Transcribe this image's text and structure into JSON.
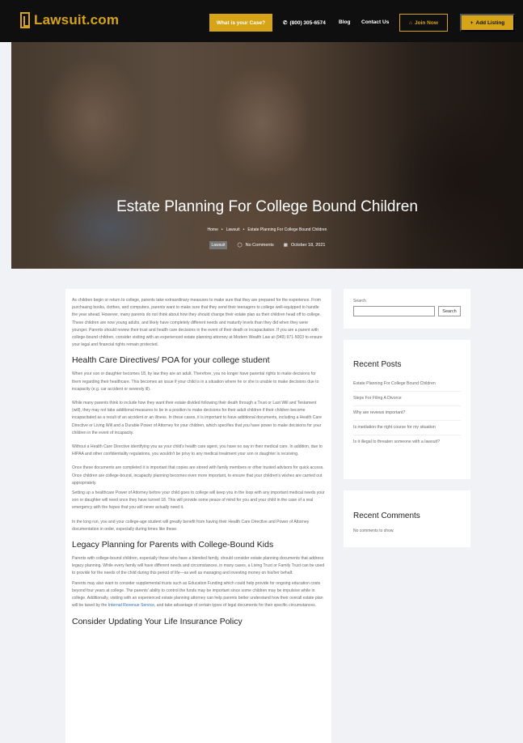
{
  "header": {
    "logo": "Lawsuit.com",
    "case_button": "What is your Case?",
    "phone": "(800) 305-6574",
    "nav_blog": "Blog",
    "nav_contact": "Contact Us",
    "join": "Join Now",
    "add_listing": "Add Listing"
  },
  "hero": {
    "title": "Estate Planning For College Bound Children",
    "breadcrumb": [
      "Home",
      "Lawsuit",
      "Estate Planning For College Bound Children"
    ],
    "tag": "Lawsuit",
    "comments": "No Comments",
    "date": "October 18, 2021"
  },
  "article": {
    "intro": "As children begin or return to college, parents take extraordinary measures to make sure that they are prepared for the experience. From purchasing books, clothes, and computers, parents want to make sure that they send their teenagers to college well-equipped to handle the year ahead. However, many parents do not think about how they should change their estate plan as their children head off to college. These children are now young adults, and likely have completely different needs and maturity levels than they did when they were younger. Parents should review their trust and health care decisions in the event of their death or incapacitation. If you are a parent with college-bound children, consider visiting with an experienced estate planning attorney at Modern Wealth Law at (949) 971-5003 to ensure your legal and financial rights remain protected.",
    "h1": "Health Care Directives/ POA for your college student",
    "p1": "When your son or daughter becomes 18, by law they are an adult. Therefore, you no longer have parental rights to make decisions for them regarding their healthcare. This becomes an issue if your child is in a situation where he or she is unable to make decisions due to incapacity (e.g. car accident or severely ill).",
    "p2": "While many parents think to include how they want their estate divided following their death through a Trust or Last Will and Testament (will), they may not take additional measures to be in a position to make decisions for their adult children if their children become incapacitated as a result of an accident or an illness. In these cases, it is important to have additional documents, including a Health Care Directive or Living Will and a Durable Power of Attorney for your children, which specifies that you have power to make decisions for your children in the event of incapacity.",
    "p3": "Without a Health Care Directive identifying you as your child's health care agent, you have no say in their medical care. In addition, due to HIPAA and other confidentiality regulations, you wouldn't be privy to any medical treatment your son or daughter is receiving.",
    "p4": "Once these documents are completed it is important that copies are stored with family members or other trusted advisors for quick access. Once children are college-bound, incapacity planning becomes even more important, to ensure that your children's wishes are carried out appropriately.",
    "p5": "Setting up a healthcare Power of Attorney before your child goes to college will keep you in the loop with any important medical needs your son or daughter will need once they have turned 18. This will provide some peace of mind for you and your child in the case of a real emergency with the hopes that you will never actually need it.",
    "p6": "In the long run, you and your college-age student will greatly benefit from having their Health Care Directive and Power of Attorney documentation in order, especially during times like these.",
    "h2": "Legacy Planning for Parents with College-Bound Kids",
    "p7": "Parents with college-bound children, especially those who have a blended family, should consider estate planning documents that address legacy planning. While every family will have different needs and circumstances, in many cases, a Living Trust or Family Trust can be used to provide for the needs of the child during this period of life—as well as managing and investing money on his/her behalf.",
    "p8_a": "Parents may also want to consider supplemental trusts such as Education Funding which could help provide for ongoing education costs beyond four years at college. The parents' ability to control the funds may be important since some children may be impulsive while in college. Additionally, visiting with an experienced estate planning attorney can help parents better understand how their overall estate plan will be taxed by the ",
    "p8_link": "Internal Revenue Service",
    "p8_b": ", and take advantage of certain types of legal documents for their specific circumstances.",
    "h3": "Consider Updating Your Life Insurance Policy"
  },
  "sidebar": {
    "search_label": "Search",
    "search_button": "Search",
    "recent_posts_title": "Recent Posts",
    "posts": [
      "Estate Planning For College Bound Children",
      "Steps For Filing A Divorce",
      "Why are reviews important?",
      "Is mediation the right course for my situation",
      "Is it illegal to threaten someone with a lawsuit?"
    ],
    "recent_comments_title": "Recent Comments",
    "no_comments": "No comments to show."
  },
  "colors": {
    "accent": "#d6a416",
    "header_bg": "#0f0f0f",
    "page_bg": "#f0f2f5"
  }
}
